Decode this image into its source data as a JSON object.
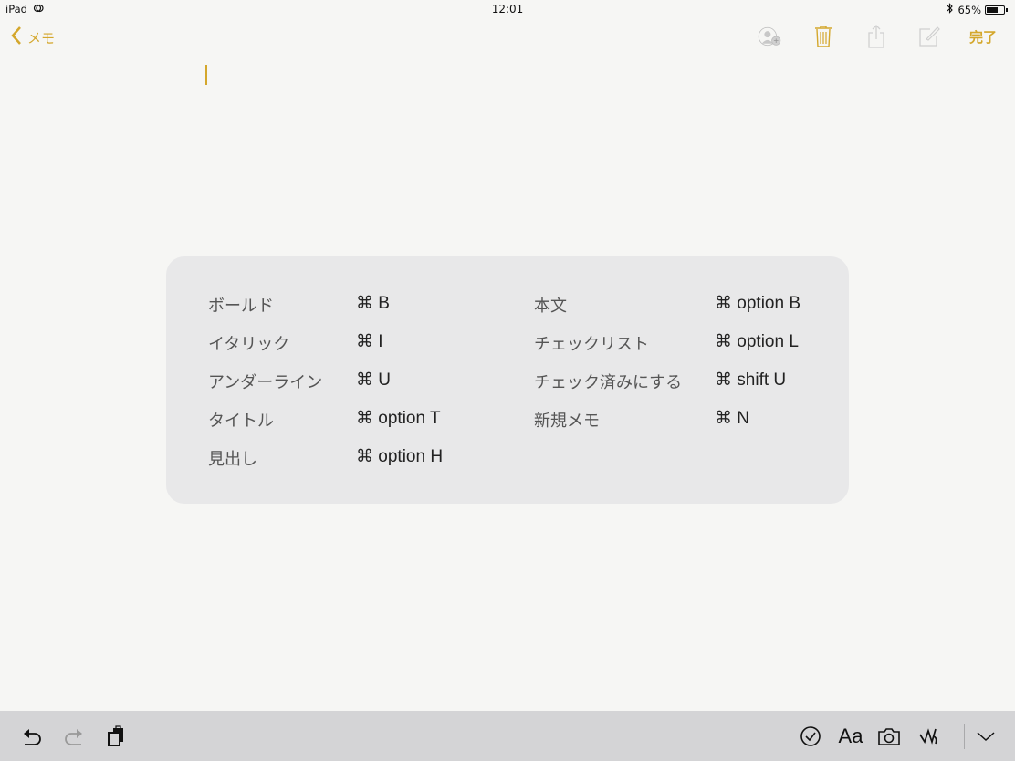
{
  "status_bar": {
    "device": "iPad",
    "time": "12:01",
    "battery_percent": "65%",
    "battery_level": 0.65
  },
  "nav": {
    "back_label": "メモ",
    "done_label": "完了",
    "icons": [
      "add-people-icon",
      "trash-icon",
      "share-icon",
      "compose-icon"
    ]
  },
  "shortcuts": {
    "left": [
      {
        "label": "ボールド",
        "key": "⌘ B"
      },
      {
        "label": "イタリック",
        "key": "⌘ I"
      },
      {
        "label": "アンダーライン",
        "key": "⌘ U"
      },
      {
        "label": "タイトル",
        "key": "⌘ option T"
      },
      {
        "label": "見出し",
        "key": "⌘ option H"
      }
    ],
    "right": [
      {
        "label": "本文",
        "key": "⌘ option B"
      },
      {
        "label": "チェックリスト",
        "key": "⌘ option L"
      },
      {
        "label": "チェック済みにする",
        "key": "⌘ shift U"
      },
      {
        "label": "新規メモ",
        "key": "⌘ N"
      }
    ]
  },
  "toolbar": {
    "format_label": "Aa",
    "icons": [
      "undo-icon",
      "redo-icon",
      "paste-icon",
      "checklist-icon",
      "format-icon",
      "camera-icon",
      "sketch-icon",
      "hide-keyboard-icon"
    ]
  },
  "colors": {
    "accent": "#d4a72c",
    "panel": "#e8e8e9",
    "toolbar": "#d4d4d6"
  }
}
